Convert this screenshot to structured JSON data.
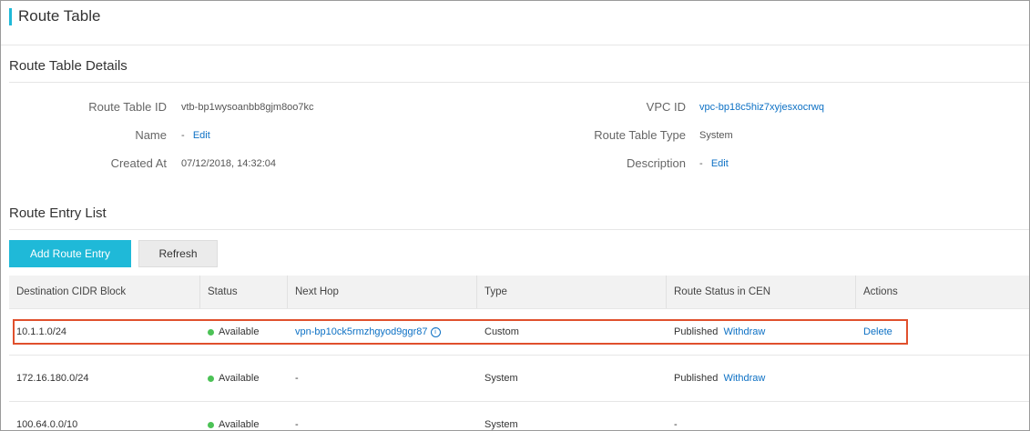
{
  "header": {
    "title": "Route Table"
  },
  "details": {
    "title": "Route Table Details",
    "route_table_id_label": "Route Table ID",
    "route_table_id_value": "vtb-bp1wysoanbb8gjm8oo7kc",
    "name_label": "Name",
    "name_value": "-",
    "name_edit": "Edit",
    "created_label": "Created At",
    "created_value": "07/12/2018, 14:32:04",
    "vpc_id_label": "VPC ID",
    "vpc_id_value": "vpc-bp18c5hiz7xyjesxocrwq",
    "type_label": "Route Table Type",
    "type_value": "System",
    "description_label": "Description",
    "description_value": "-",
    "description_edit": "Edit"
  },
  "entries": {
    "title": "Route Entry List",
    "add_button": "Add Route Entry",
    "refresh_button": "Refresh",
    "columns": [
      "Destination CIDR Block",
      "Status",
      "Next Hop",
      "Type",
      "Route Status in CEN",
      "Actions"
    ],
    "rows": [
      {
        "cidr": "10.1.1.0/24",
        "status": "Available",
        "next_hop": "vpn-bp10ck5rmzhgyod9ggr87",
        "type": "Custom",
        "cen_status": "Published",
        "cen_action": "Withdraw",
        "action": "Delete"
      },
      {
        "cidr": "172.16.180.0/24",
        "status": "Available",
        "next_hop": "-",
        "type": "System",
        "cen_status": "Published",
        "cen_action": "Withdraw",
        "action": ""
      },
      {
        "cidr": "100.64.0.0/10",
        "status": "Available",
        "next_hop": "-",
        "type": "System",
        "cen_status": "-",
        "cen_action": "",
        "action": ""
      }
    ]
  },
  "colors": {
    "accent": "#1fb9d8",
    "link": "#0c70c4",
    "available": "#4cc256",
    "highlight": "#e0502d"
  }
}
